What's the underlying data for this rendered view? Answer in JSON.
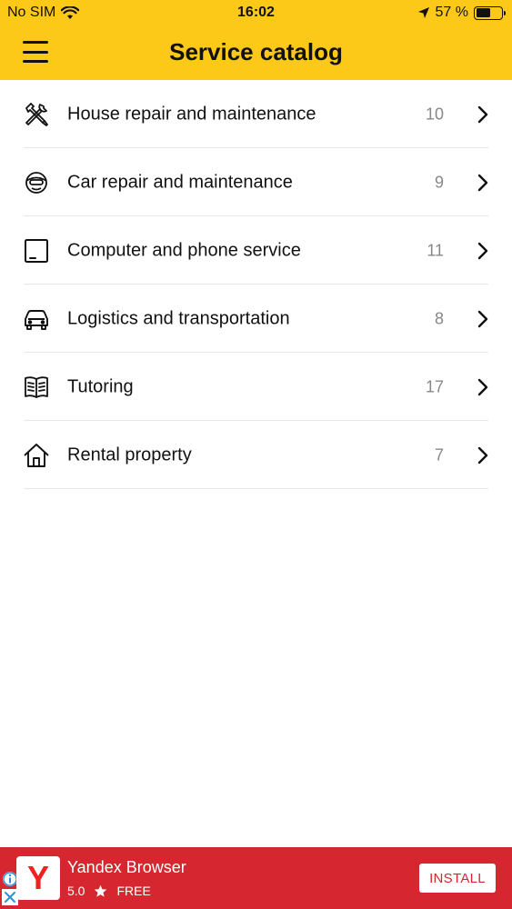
{
  "status_bar": {
    "carrier": "No SIM",
    "time": "16:02",
    "battery": "57 %",
    "battery_level": 0.57
  },
  "header": {
    "title": "Service catalog",
    "menu_icon": "hamburger-icon",
    "background_color": "#fcc919"
  },
  "categories": [
    {
      "label": "House repair and maintenance",
      "count": "10",
      "icon": "tools-icon"
    },
    {
      "label": "Car repair and maintenance",
      "count": "9",
      "icon": "mechanic-icon"
    },
    {
      "label": "Computer and phone service",
      "count": "11",
      "icon": "tablet-icon"
    },
    {
      "label": "Logistics and transportation",
      "count": "8",
      "icon": "car-icon"
    },
    {
      "label": "Tutoring",
      "count": "17",
      "icon": "book-icon"
    },
    {
      "label": "Rental property",
      "count": "7",
      "icon": "house-icon"
    }
  ],
  "ad": {
    "title": "Yandex Browser",
    "rating": "5.0",
    "price": "FREE",
    "button_label": "INSTALL",
    "logo_letter": "Y",
    "background_color": "#d6262f"
  }
}
